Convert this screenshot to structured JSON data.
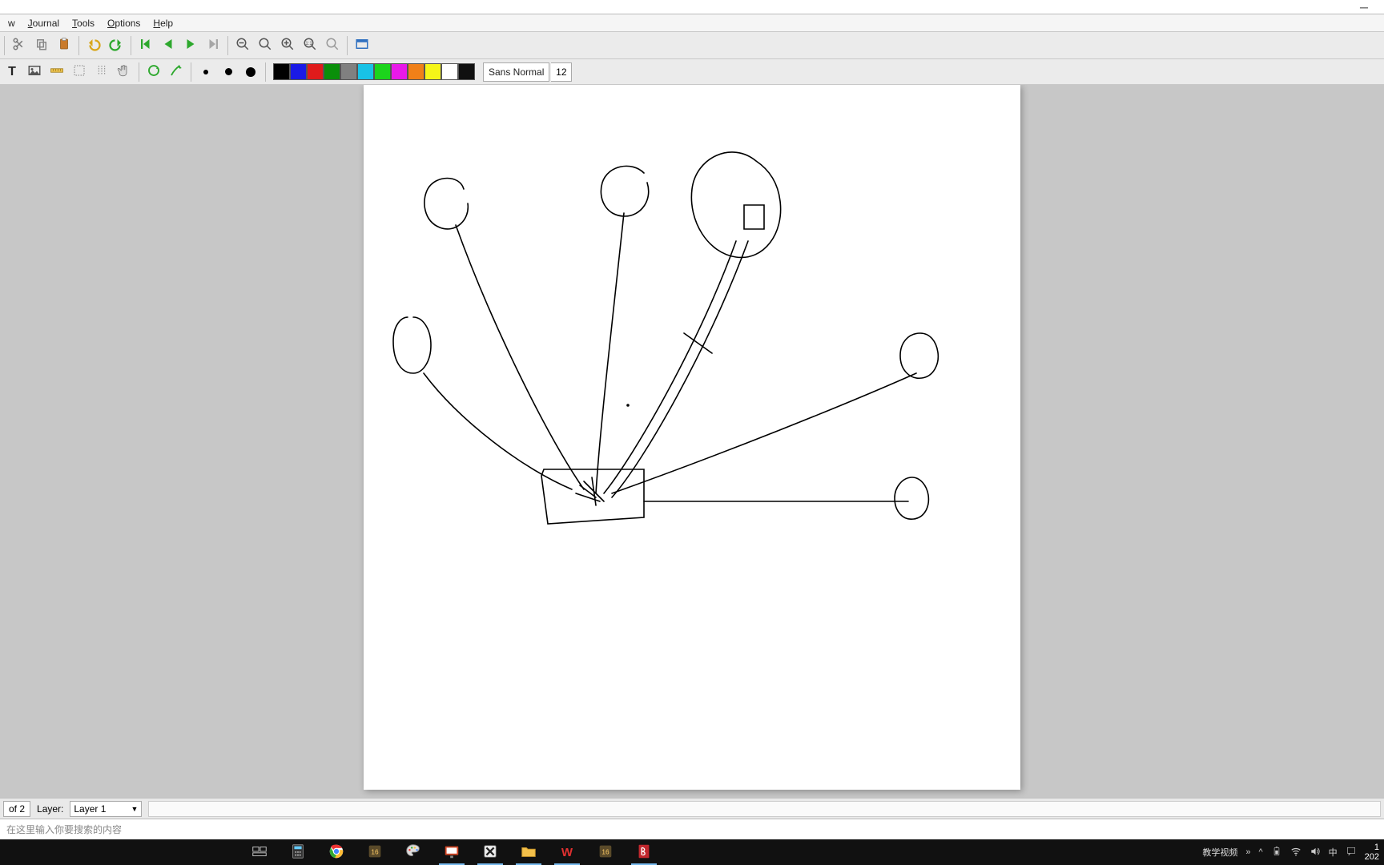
{
  "menus": {
    "view": "w",
    "journal": "Journal",
    "tools": "Tools",
    "options": "Options",
    "help": "Help"
  },
  "font": {
    "name": "Sans Normal",
    "size": "12"
  },
  "colors": [
    "#000000",
    "#1a1ae6",
    "#e01b1b",
    "#0a8f0a",
    "#808080",
    "#18c2e6",
    "#1cd41c",
    "#e818e8",
    "#f08018",
    "#f5f518",
    "#ffffff",
    "#101010"
  ],
  "status": {
    "page": "of 2",
    "layer_label": "Layer:",
    "layer_value": "Layer 1"
  },
  "search": {
    "placeholder": "在这里输入你要搜索的内容"
  },
  "systray": {
    "label1": "教学视频",
    "ime": "中",
    "time": "1",
    "date": "202"
  }
}
